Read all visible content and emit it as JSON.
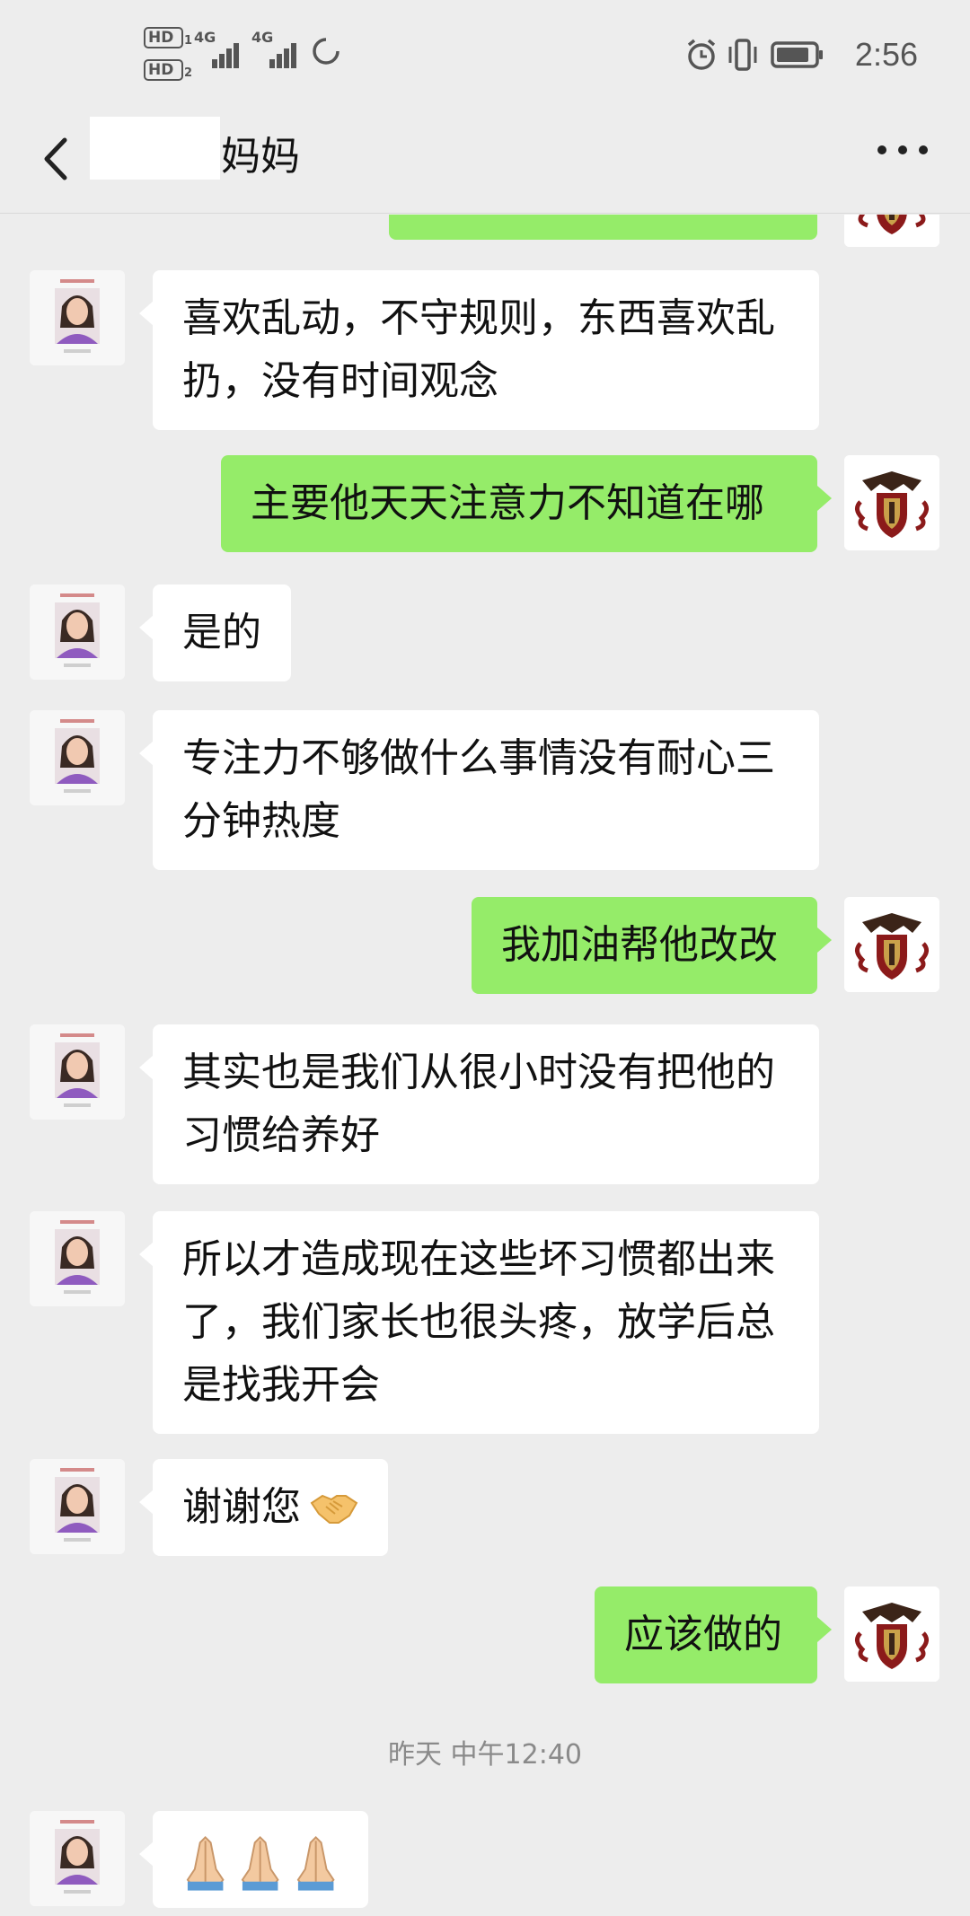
{
  "status_bar": {
    "sim1": "HD",
    "sim1_index": "1",
    "sim2": "HD",
    "sim2_index": "2",
    "network1": "4G",
    "network2": "4G",
    "time": "2:56"
  },
  "header": {
    "title": "妈妈"
  },
  "messages": [
    {
      "side": "out",
      "text": "",
      "partial": true
    },
    {
      "side": "in",
      "lines": [
        "喜欢乱动，不守规则，东西喜欢乱",
        "扔，没有时间观念"
      ]
    },
    {
      "side": "out",
      "lines": [
        "主要他天天注意力不知道在哪"
      ]
    },
    {
      "side": "in",
      "lines": [
        "是的"
      ]
    },
    {
      "side": "in",
      "lines": [
        "专注力不够做什么事情没有耐心三",
        "分钟热度"
      ]
    },
    {
      "side": "out",
      "lines": [
        "我加油帮他改改"
      ]
    },
    {
      "side": "in",
      "lines": [
        "其实也是我们从很小时没有把他的",
        "习惯给养好"
      ]
    },
    {
      "side": "in",
      "lines": [
        "所以才造成现在这些坏习惯都出来",
        "了，我们家长也很头疼，放学后总",
        "是找我开会"
      ]
    },
    {
      "side": "in",
      "lines": [
        "谢谢您"
      ],
      "emoji": "handshake"
    },
    {
      "side": "out",
      "lines": [
        "应该做的"
      ]
    },
    {
      "side": "in",
      "emoji": "folded-hands-x3"
    }
  ],
  "timestamp": "昨天 中午12:40",
  "colors": {
    "background": "#ededed",
    "bubble_out": "#95ec69",
    "bubble_in": "#ffffff",
    "avatar_teacher_shirt": "#8f5bbf",
    "avatar_self_crest": "#8b1a1a"
  }
}
